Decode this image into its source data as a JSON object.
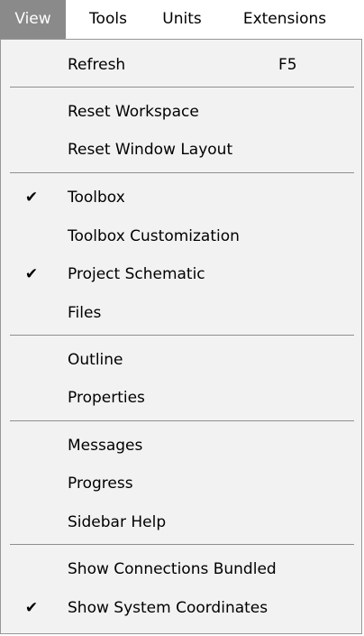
{
  "menubar": {
    "items": [
      {
        "label": "View"
      },
      {
        "label": "Tools"
      },
      {
        "label": "Units"
      },
      {
        "label": "Extensions"
      }
    ],
    "active_item": "View"
  },
  "view_menu": {
    "items": [
      {
        "label": "Refresh",
        "shortcut": "F5",
        "checked": false
      },
      {
        "label": "Reset Workspace",
        "checked": false
      },
      {
        "label": "Reset Window Layout",
        "checked": false
      },
      {
        "label": "Toolbox",
        "checked": true
      },
      {
        "label": "Toolbox Customization",
        "checked": false
      },
      {
        "label": "Project Schematic",
        "checked": true
      },
      {
        "label": "Files",
        "checked": false
      },
      {
        "label": "Outline",
        "checked": false
      },
      {
        "label": "Properties",
        "checked": false
      },
      {
        "label": "Messages",
        "checked": false
      },
      {
        "label": "Progress",
        "checked": false
      },
      {
        "label": "Sidebar Help",
        "checked": false
      },
      {
        "label": "Show Connections Bundled",
        "checked": false
      },
      {
        "label": "Show System Coordinates",
        "checked": true
      }
    ],
    "check_glyph": "✔"
  },
  "colors": {
    "active_menubar_bg": "#8a8a8a",
    "dropdown_bg": "#f2f2f2",
    "separator": "#8e8e8e"
  }
}
